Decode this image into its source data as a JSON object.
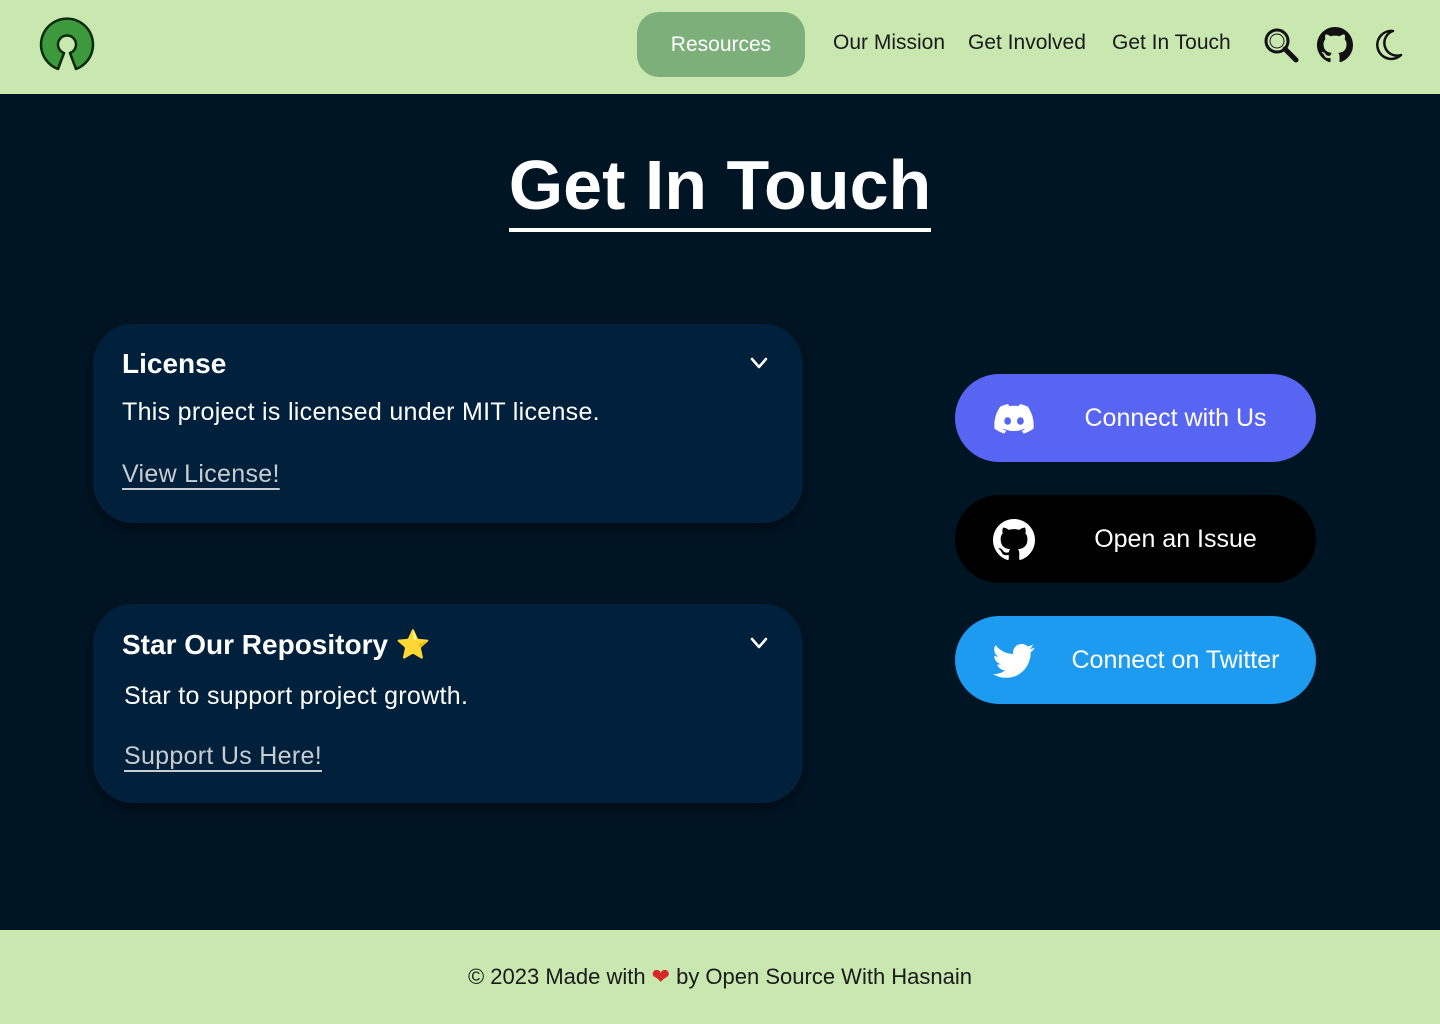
{
  "header": {
    "logo_name": "open-source-logo",
    "nav": {
      "resources": "Resources",
      "mission": "Our Mission",
      "involved": "Get Involved",
      "touch": "Get In Touch"
    },
    "icons": [
      "search-icon",
      "github-icon",
      "moon-icon"
    ]
  },
  "main": {
    "title": "Get In Touch",
    "cards": [
      {
        "title": "License",
        "text": "This project is licensed under MIT license.",
        "link": "View License!"
      },
      {
        "title": "Star Our Repository ⭐",
        "text": "Star to support project growth.",
        "link": "Support Us Here!"
      }
    ],
    "social": {
      "discord": "Connect with Us",
      "issue": "Open an Issue",
      "twitter": "Connect on Twitter"
    }
  },
  "footer": {
    "prefix": "© 2023 Made with",
    "heart": "❤",
    "suffix": "by Open Source With Hasnain"
  },
  "colors": {
    "header_bg": "#c8e8b0",
    "page_bg": "#001524",
    "card_bg": "#01203b",
    "pill": "#7daf7b",
    "discord": "#5865f2",
    "github": "#000000",
    "twitter": "#1d9bf0"
  }
}
